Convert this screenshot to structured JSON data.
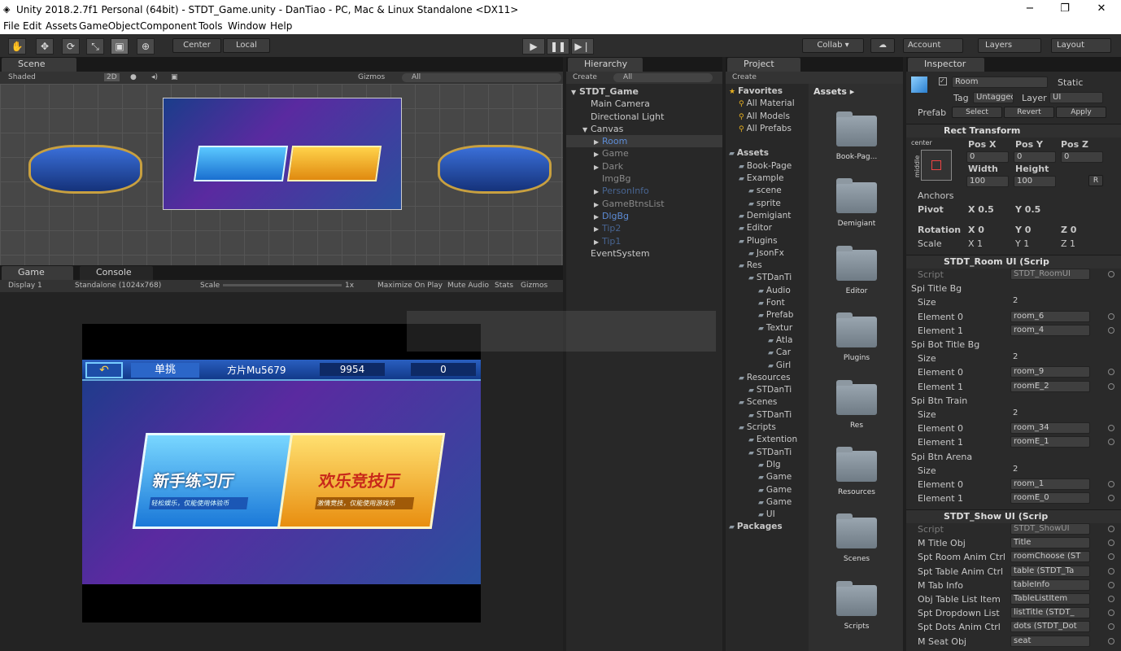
{
  "title": "Unity 2018.2.7f1 Personal (64bit) - STDT_Game.unity - DanTiao - PC, Mac & Linux Standalone <DX11>",
  "window_controls": [
    "−",
    "❐",
    "✕"
  ],
  "menu": [
    "File",
    "Edit",
    "Assets",
    "GameObject",
    "Component",
    "Tools",
    "Window",
    "Help"
  ],
  "toolbar": {
    "center": "Center",
    "local": "Local",
    "collab": "Collab ▾",
    "account": "Account",
    "layers": "Layers",
    "layout": "Layout"
  },
  "scene": {
    "tab": "Scene",
    "shaded": "Shaded",
    "mode2d": "2D",
    "gizmos": "Gizmos",
    "search": "All"
  },
  "game": {
    "tab": "Game",
    "console_tab": "Console",
    "display": "Display 1",
    "resolution": "Standalone (1024x768)",
    "scale_label": "Scale",
    "scale_value": "1x",
    "maximize": "Maximize On Play",
    "mute": "Mute Audio",
    "stats": "Stats",
    "gizmos": "Gizmos"
  },
  "game_ui": {
    "mode": "单挑",
    "player": "方片Mu5679",
    "coins": "9954",
    "gold": "0",
    "card1_title": "新手练习厅",
    "card1_sub": "轻松娱乐，仅能使用体验币",
    "card2_title": "欢乐竞技厅",
    "card2_sub": "激情竞技，仅能使用游戏币"
  },
  "hierarchy": {
    "tab": "Hierarchy",
    "create": "Create",
    "search": "All",
    "items": [
      {
        "label": "STDT_Game",
        "indent": 0,
        "style": "bold"
      },
      {
        "label": "Main Camera",
        "indent": 1,
        "style": ""
      },
      {
        "label": "Directional Light",
        "indent": 1,
        "style": ""
      },
      {
        "label": "Canvas",
        "indent": 1,
        "style": "",
        "arrow": "▼"
      },
      {
        "label": "Room",
        "indent": 2,
        "style": "blue sel",
        "arrow": "▶"
      },
      {
        "label": "Game",
        "indent": 2,
        "style": "dim",
        "arrow": "▶"
      },
      {
        "label": "Dark",
        "indent": 2,
        "style": "dim",
        "arrow": "▶"
      },
      {
        "label": "ImgBg",
        "indent": 2,
        "style": "dim"
      },
      {
        "label": "PersonInfo",
        "indent": 2,
        "style": "bluedim",
        "arrow": "▶"
      },
      {
        "label": "GameBtnsList",
        "indent": 2,
        "style": "dim",
        "arrow": "▶"
      },
      {
        "label": "DlgBg",
        "indent": 2,
        "style": "blue",
        "arrow": "▶"
      },
      {
        "label": "Tip2",
        "indent": 2,
        "style": "bluedim",
        "arrow": "▶"
      },
      {
        "label": "Tip1",
        "indent": 2,
        "style": "bluedim",
        "arrow": "▶"
      },
      {
        "label": "EventSystem",
        "indent": 1,
        "style": ""
      }
    ]
  },
  "project": {
    "tab": "Project",
    "create": "Create",
    "assets_header": "Assets ▸",
    "tree": [
      {
        "label": "Favorites",
        "indent": 0,
        "style": "bold"
      },
      {
        "label": "All Material",
        "indent": 1
      },
      {
        "label": "All Models",
        "indent": 1
      },
      {
        "label": "All Prefabs",
        "indent": 1
      },
      {
        "label": "",
        "indent": 0
      },
      {
        "label": "Assets",
        "indent": 0,
        "style": "bold"
      },
      {
        "label": "Book-Page",
        "indent": 1
      },
      {
        "label": "Example",
        "indent": 1
      },
      {
        "label": "scene",
        "indent": 2
      },
      {
        "label": "sprite",
        "indent": 2
      },
      {
        "label": "Demigiant",
        "indent": 1
      },
      {
        "label": "Editor",
        "indent": 1
      },
      {
        "label": "Plugins",
        "indent": 1
      },
      {
        "label": "JsonFx",
        "indent": 2
      },
      {
        "label": "Res",
        "indent": 1
      },
      {
        "label": "STDanTi",
        "indent": 2
      },
      {
        "label": "Audio",
        "indent": 3
      },
      {
        "label": "Font",
        "indent": 3
      },
      {
        "label": "Prefab",
        "indent": 3
      },
      {
        "label": "Textur",
        "indent": 3
      },
      {
        "label": "Atla",
        "indent": 4
      },
      {
        "label": "Car",
        "indent": 4
      },
      {
        "label": "Girl",
        "indent": 4
      },
      {
        "label": "Resources",
        "indent": 1
      },
      {
        "label": "STDanTi",
        "indent": 2
      },
      {
        "label": "Scenes",
        "indent": 1
      },
      {
        "label": "STDanTi",
        "indent": 2
      },
      {
        "label": "Scripts",
        "indent": 1
      },
      {
        "label": "Extention",
        "indent": 2
      },
      {
        "label": "STDanTi",
        "indent": 2
      },
      {
        "label": "Dlg",
        "indent": 3
      },
      {
        "label": "Game",
        "indent": 3
      },
      {
        "label": "Game",
        "indent": 3
      },
      {
        "label": "Game",
        "indent": 3
      },
      {
        "label": "UI",
        "indent": 3
      },
      {
        "label": "Packages",
        "indent": 0,
        "style": "bold"
      }
    ],
    "folders": [
      "Book-Pag...",
      "Demigiant",
      "Editor",
      "Plugins",
      "Res",
      "Resources",
      "Scenes",
      "Scripts"
    ]
  },
  "inspector": {
    "tab": "Inspector",
    "name": "Room",
    "static": "Static",
    "tag_label": "Tag",
    "tag": "Untagged",
    "layer_label": "Layer",
    "layer": "UI",
    "prefab_label": "Prefab",
    "select": "Select",
    "revert": "Revert",
    "apply": "Apply",
    "rect_title": "Rect Transform",
    "anchor_h": "center",
    "anchor_v": "middle",
    "posx_l": "Pos X",
    "posy_l": "Pos Y",
    "posz_l": "Pos Z",
    "posx": "0",
    "posy": "0",
    "posz": "0",
    "width_l": "Width",
    "height_l": "Height",
    "width": "100",
    "height": "100",
    "r_btn": "R",
    "anchors": "Anchors",
    "pivot": "Pivot",
    "pivot_x": "X 0.5",
    "pivot_y": "Y 0.5",
    "rotation": "Rotation",
    "rot_x": "X 0",
    "rot_y": "Y 0",
    "rot_z": "Z 0",
    "scale": "Scale",
    "sc_x": "X 1",
    "sc_y": "Y 1",
    "sc_z": "Z 1",
    "comp1_title": "STDT_Room UI (Scrip",
    "comp2_title": "STDT_Show UI (Scrip",
    "rows1": [
      {
        "label": "Script",
        "value": "STDT_RoomUI",
        "kind": "script"
      },
      {
        "label": "Spi Title Bg",
        "kind": "header"
      },
      {
        "label": "Size",
        "value": "2",
        "kind": "num"
      },
      {
        "label": "Element 0",
        "value": "room_6",
        "kind": "ref"
      },
      {
        "label": "Element 1",
        "value": "room_4",
        "kind": "ref"
      },
      {
        "label": "Spi Bot Title Bg",
        "kind": "header"
      },
      {
        "label": "Size",
        "value": "2",
        "kind": "num"
      },
      {
        "label": "Element 0",
        "value": "room_9",
        "kind": "ref"
      },
      {
        "label": "Element 1",
        "value": "roomE_2",
        "kind": "ref"
      },
      {
        "label": "Spi Btn Train",
        "kind": "header"
      },
      {
        "label": "Size",
        "value": "2",
        "kind": "num"
      },
      {
        "label": "Element 0",
        "value": "room_34",
        "kind": "ref"
      },
      {
        "label": "Element 1",
        "value": "roomE_1",
        "kind": "ref"
      },
      {
        "label": "Spi Btn Arena",
        "kind": "header"
      },
      {
        "label": "Size",
        "value": "2",
        "kind": "num"
      },
      {
        "label": "Element 0",
        "value": "room_1",
        "kind": "ref"
      },
      {
        "label": "Element 1",
        "value": "roomE_0",
        "kind": "ref"
      }
    ],
    "rows2": [
      {
        "label": "Script",
        "value": "STDT_ShowUI",
        "kind": "script"
      },
      {
        "label": "M Title Obj",
        "value": "Title",
        "kind": "ref"
      },
      {
        "label": "Spt Room Anim Ctrl",
        "value": "roomChoose (ST",
        "kind": "ref"
      },
      {
        "label": "Spt Table Anim Ctrl",
        "value": "table (STDT_Ta",
        "kind": "ref"
      },
      {
        "label": "M Tab Info",
        "value": "tableInfo",
        "kind": "ref"
      },
      {
        "label": "Obj Table List Item",
        "value": "TableListItem",
        "kind": "ref"
      },
      {
        "label": "Spt Dropdown List",
        "value": "listTitle (STDT_",
        "kind": "ref"
      },
      {
        "label": "Spt Dots Anim Ctrl",
        "value": "dots (STDT_Dot",
        "kind": "ref"
      },
      {
        "label": "M Seat Obj",
        "value": "seat",
        "kind": "ref"
      }
    ]
  },
  "colors": {
    "accent": "#5d8cd6",
    "panel": "#282828",
    "tabbar": "#191919"
  }
}
